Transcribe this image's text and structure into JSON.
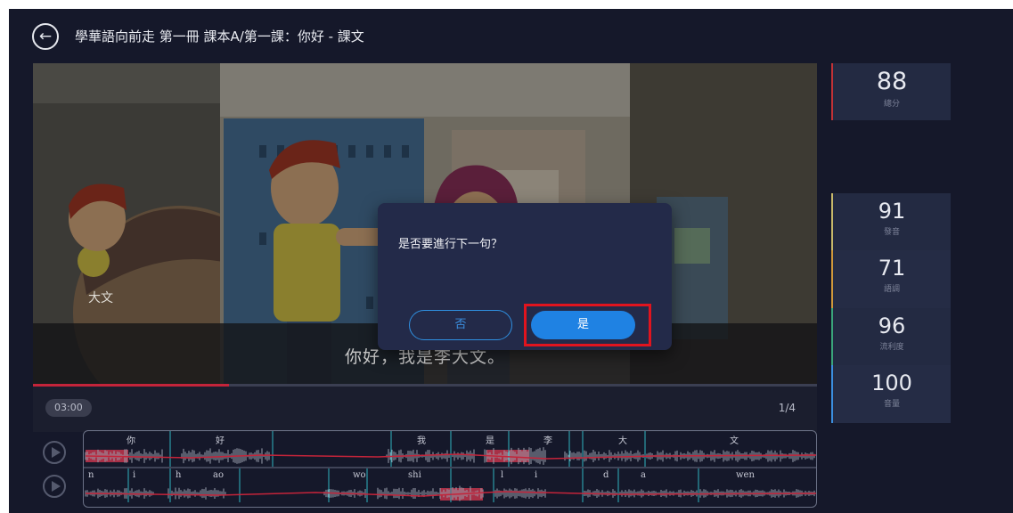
{
  "header": {
    "back_icon": "←",
    "title": "學華語向前走 第一冊 課本A/第一課：你好 - 課文"
  },
  "video": {
    "speaker_name": "大文",
    "subtitle": "你好，我是李大文。",
    "progress_fraction": 0.25,
    "elapsed_time": "03:00",
    "page_indicator": "1/4"
  },
  "dialog": {
    "message": "是否要進行下一句？",
    "no_label": "否",
    "yes_label": "是"
  },
  "scores": {
    "total": {
      "value": "88",
      "label": "總分"
    },
    "items": [
      {
        "value": "91",
        "label": "發音"
      },
      {
        "value": "71",
        "label": "語調"
      },
      {
        "value": "96",
        "label": "流利度"
      },
      {
        "value": "100",
        "label": "音量"
      }
    ]
  },
  "waveform": {
    "characters": [
      "你",
      "好",
      "我",
      "是",
      "李",
      "大",
      "文"
    ],
    "pinyin": [
      "n",
      "i",
      "h",
      "ao",
      "wo",
      "shi",
      "l",
      "i",
      "d",
      "a",
      "wen"
    ]
  },
  "colors": {
    "accent_blue": "#1f82e3",
    "highlight_red": "#e0141e",
    "progress_red": "#c4243a"
  }
}
